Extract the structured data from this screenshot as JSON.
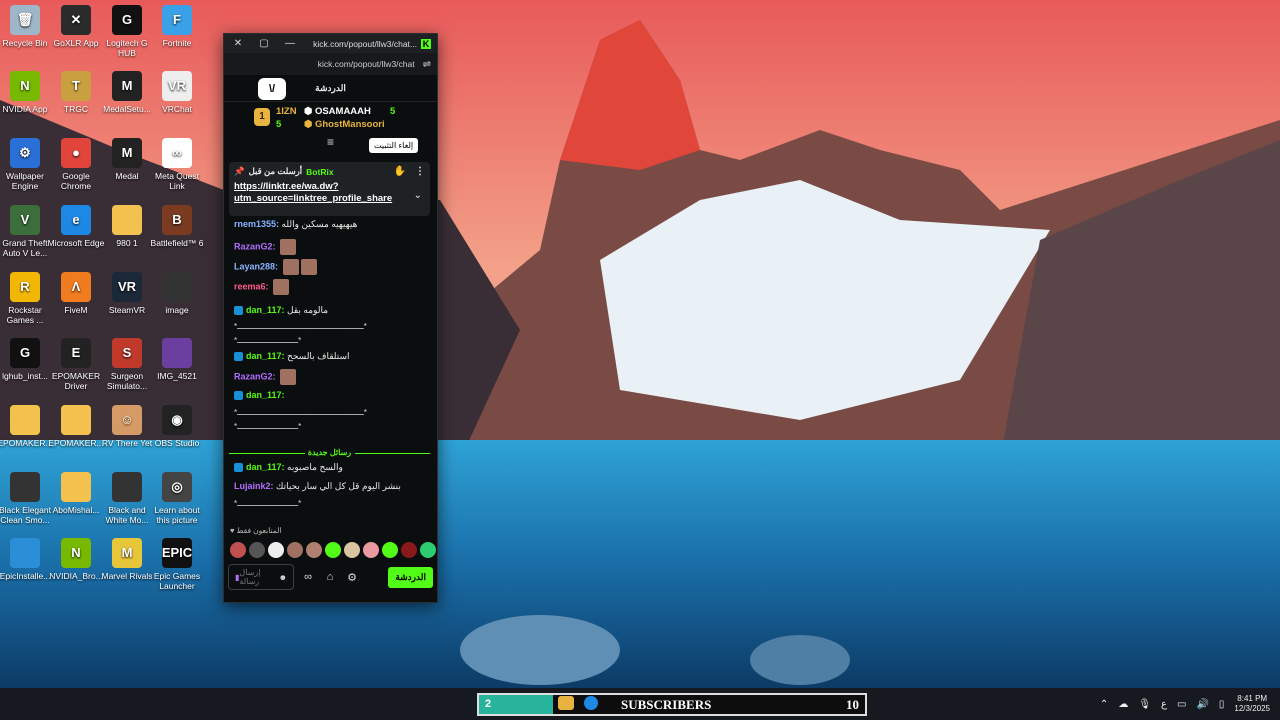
{
  "desktop": {
    "icons": [
      {
        "label": "Recycle Bin",
        "name": "recycle-bin-icon",
        "color": "#9fb6c8",
        "glyph": "🗑"
      },
      {
        "label": "GoXLR App",
        "name": "goxlr-icon",
        "color": "#2b2b2b",
        "glyph": "✕"
      },
      {
        "label": "Logitech G HUB",
        "name": "logitech-ghub-icon",
        "color": "#111",
        "glyph": "G"
      },
      {
        "label": "Fortnite",
        "name": "fortnite-icon",
        "color": "#3aa0e8",
        "glyph": "F"
      },
      {
        "label": "NVIDIA App",
        "name": "nvidia-app-icon",
        "color": "#76b900",
        "glyph": "N"
      },
      {
        "label": "TRGC",
        "name": "trgc-icon",
        "color": "#c9a040",
        "glyph": "T"
      },
      {
        "label": "MedalSetu...",
        "name": "medal-setup-icon",
        "color": "#222",
        "glyph": "M"
      },
      {
        "label": "VRChat",
        "name": "vrchat-icon",
        "color": "#eee",
        "glyph": "VR"
      },
      {
        "label": "Wallpaper Engine",
        "name": "wallpaper-engine-icon",
        "color": "#2a6fd6",
        "glyph": "⚙"
      },
      {
        "label": "Google Chrome",
        "name": "chrome-icon",
        "color": "#e0443a",
        "glyph": "●"
      },
      {
        "label": "Medal",
        "name": "medal-icon",
        "color": "#222",
        "glyph": "M"
      },
      {
        "label": "Meta Quest Link",
        "name": "meta-quest-icon",
        "color": "#fff",
        "glyph": "∞"
      },
      {
        "label": "Grand Theft Auto V Le...",
        "name": "gta-v-icon",
        "color": "#3c6e3c",
        "glyph": "V"
      },
      {
        "label": "Microsoft Edge",
        "name": "edge-icon",
        "color": "#1e88e5",
        "glyph": "e"
      },
      {
        "label": "980 1",
        "name": "folder-980-icon",
        "color": "#f2c14e",
        "glyph": ""
      },
      {
        "label": "Battlefield™ 6",
        "name": "battlefield-icon",
        "color": "#7a3b20",
        "glyph": "B"
      },
      {
        "label": "Rockstar Games ...",
        "name": "rockstar-icon",
        "color": "#f2b705",
        "glyph": "R"
      },
      {
        "label": "FiveM",
        "name": "fivem-icon",
        "color": "#f07c1f",
        "glyph": "Λ"
      },
      {
        "label": "SteamVR",
        "name": "steamvr-icon",
        "color": "#1b2838",
        "glyph": "VR"
      },
      {
        "label": "image",
        "name": "image-icon",
        "color": "#333",
        "glyph": ""
      },
      {
        "label": "lghub_inst...",
        "name": "lghub-installer-icon",
        "color": "#111",
        "glyph": "G"
      },
      {
        "label": "EPOMAKER Driver",
        "name": "epomaker-driver-icon",
        "color": "#222",
        "glyph": "E"
      },
      {
        "label": "Surgeon Simulato...",
        "name": "surgeon-simulator-icon",
        "color": "#c0392b",
        "glyph": "S"
      },
      {
        "label": "IMG_4521",
        "name": "img-4521-icon",
        "color": "#6b3fa0",
        "glyph": ""
      },
      {
        "label": "EPOMAKER...",
        "name": "epomaker-folder-icon-1",
        "color": "#f2c14e",
        "glyph": ""
      },
      {
        "label": "EPOMAKER...",
        "name": "epomaker-folder-icon-2",
        "color": "#f2c14e",
        "glyph": ""
      },
      {
        "label": "RV There Yet",
        "name": "rv-there-yet-icon",
        "color": "#d59a66",
        "glyph": "☺"
      },
      {
        "label": "OBS Studio",
        "name": "obs-studio-icon",
        "color": "#222",
        "glyph": "◉"
      },
      {
        "label": "Black Elegant Clean Smo...",
        "name": "black-elegant-icon",
        "color": "#333",
        "glyph": ""
      },
      {
        "label": "AboMishal...",
        "name": "abomishal-folder-icon",
        "color": "#f2c14e",
        "glyph": ""
      },
      {
        "label": "Black and White Mo...",
        "name": "black-white-icon",
        "color": "#333",
        "glyph": ""
      },
      {
        "label": "Learn about this picture",
        "name": "learn-picture-icon",
        "color": "#444",
        "glyph": "◎"
      },
      {
        "label": "EpicInstalle...",
        "name": "epic-installer-icon",
        "color": "#2a8fd6",
        "glyph": ""
      },
      {
        "label": "NVIDIA_Bro...",
        "name": "nvidia-broadcast-icon",
        "color": "#76b900",
        "glyph": "N"
      },
      {
        "label": "Marvel Rivals",
        "name": "marvel-rivals-icon",
        "color": "#e8c63a",
        "glyph": "M"
      },
      {
        "label": "Epic Games Launcher",
        "name": "epic-games-icon",
        "color": "#111",
        "glyph": "EPIC"
      }
    ]
  },
  "popout": {
    "url_title": "kick.com/popout/llw3/chat...",
    "url_bar": "kick.com/popout/llw3/chat",
    "header_title": "الدردشة",
    "header_icon_text": "\\/",
    "gifters": {
      "rank": "1",
      "top_left_name": "1IZN",
      "top_left_count": "5",
      "bottom_left_count": "5",
      "first_name": "OSAMAAAH",
      "first_count": "5",
      "second_name": "GhostMansoori"
    },
    "tooltip": "إلغاء التثبيت",
    "pinned": {
      "label": "أرسلت من قبل",
      "user": "BotRix",
      "link_line1": "https://linktr.ee/wa.dw?",
      "link_line2": "utm_source=linktree_profile_share"
    },
    "messages": [
      {
        "user": "rnem1355:",
        "text": "هيهيهيه مسكين والله",
        "color": "#8ab4ff"
      },
      {
        "user": "RazanG2:",
        "text": "",
        "color": "#b46cff"
      },
      {
        "user": "Layan288:",
        "text": "",
        "color": "#8ab4ff"
      },
      {
        "user": "reema6:",
        "text": "",
        "color": "#ff5a8a"
      },
      {
        "user": "dan_117:",
        "text": "مالومه بقل",
        "color": "#53fc18"
      },
      {
        "user": "",
        "text": "*ــــــــــــــــــــــــــــــــــــــــــــــــــــــ*",
        "color": "#ddd"
      },
      {
        "user": "",
        "text": "*ــــــــــــــــــــــــــ*",
        "color": "#ddd"
      },
      {
        "user": "dan_117:",
        "text": "استلقاف بالسحح",
        "color": "#53fc18"
      },
      {
        "user": "RazanG2:",
        "text": "",
        "color": "#b46cff"
      },
      {
        "user": "dan_117:",
        "text": "",
        "color": "#53fc18"
      },
      {
        "user": "",
        "text": "*ــــــــــــــــــــــــــــــــــــــــــــــــــــــ*",
        "color": "#ddd"
      },
      {
        "user": "",
        "text": "*ــــــــــــــــــــــــــ*",
        "color": "#ddd"
      },
      {
        "user": "dan_117:",
        "text": "والسح ماصبوبه",
        "color": "#53fc18"
      },
      {
        "user": "Lujaink2:",
        "text": "بنشر اليوم قل كل الي سار بحياتك",
        "color": "#b46cff"
      },
      {
        "user": "",
        "text": "*ــــــــــــــــــــــــــ*",
        "color": "#ddd"
      }
    ],
    "new_messages_label": "رسائل جديدة",
    "followers_only": "المتابعون فقط",
    "composer_placeholder": "إرسال رسالة",
    "send_label": "الدردشة"
  },
  "taskbar": {
    "sub_count": "2",
    "sub_label": "SUBSCRIBERS",
    "sub_goal": "10",
    "lang": "ع",
    "time": "8:41 PM",
    "date": "12/3/2025"
  }
}
